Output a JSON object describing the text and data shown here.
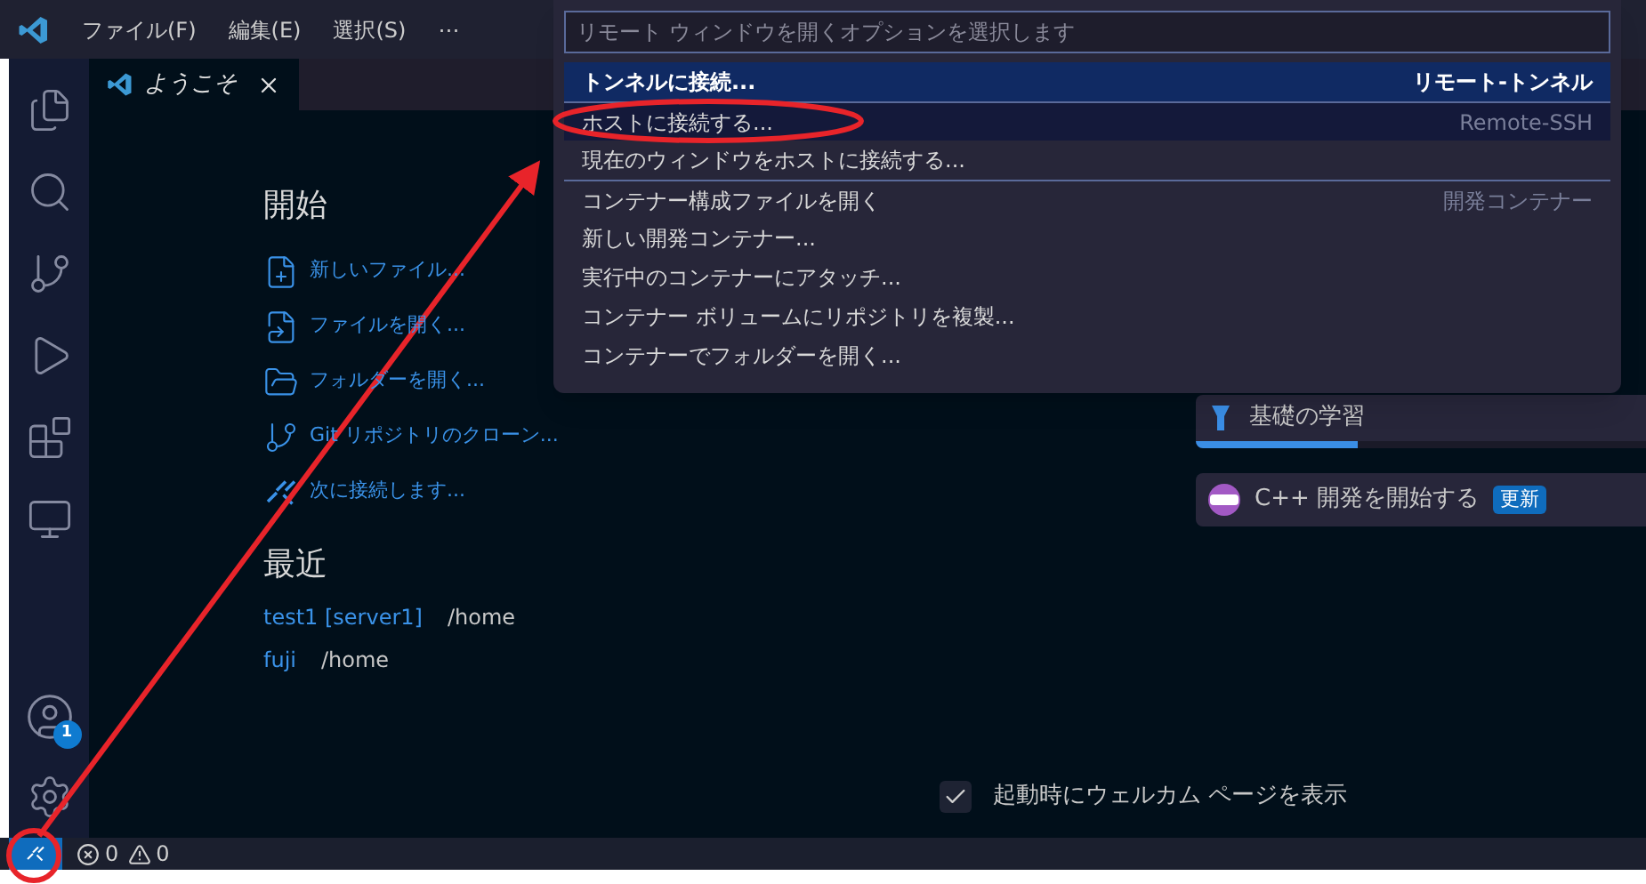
{
  "menu": [
    "ファイル(F)",
    "編集(E)",
    "選択(S)",
    "⋯"
  ],
  "activity_bar": [
    {
      "kind": "files"
    },
    {
      "kind": "search"
    },
    {
      "kind": "source-control"
    },
    {
      "kind": "run"
    },
    {
      "kind": "extensions"
    },
    {
      "kind": "remote"
    }
  ],
  "activity_bottom": {
    "accounts_badge": "1"
  },
  "tab": {
    "label": "ようこそ"
  },
  "start": {
    "title": "開始",
    "items": [
      {
        "kind": "new-file",
        "label": "新しいファイル..."
      },
      {
        "kind": "open-file",
        "label": "ファイルを開く..."
      },
      {
        "kind": "open-folder",
        "label": "フォルダーを開く..."
      },
      {
        "kind": "clone",
        "label": "Git リポジトリのクローン..."
      },
      {
        "kind": "connect",
        "label": "次に接続します..."
      }
    ]
  },
  "recent": {
    "title": "最近",
    "items": [
      {
        "name": "test1 [server1]",
        "path": "/home"
      },
      {
        "name": "fuji",
        "path": "/home"
      }
    ]
  },
  "walkthroughs": [
    {
      "kind": "progress",
      "title": "基礎の学習",
      "level": 0.35
    },
    {
      "kind": "badge",
      "title": "C++ 開発を開始する",
      "badge": "更新"
    }
  ],
  "welcome_checkbox": {
    "label": "起動時にウェルカム ページを表示",
    "checked": true
  },
  "quick_pick": {
    "placeholder": "リモート ウィンドウを開くオプションを選択します",
    "items": [
      {
        "label": "トンネルに接続...",
        "detail": "リモート-トンネル",
        "selected": true,
        "hovered": false,
        "group_start": false
      },
      {
        "label": "ホストに接続する...",
        "detail": "Remote-SSH",
        "selected": false,
        "hovered": true,
        "group_start": true
      },
      {
        "label": "現在のウィンドウをホストに接続する...",
        "selected": false,
        "hovered": false,
        "group_start": false
      },
      {
        "label": "コンテナー構成ファイルを開く",
        "detail": "開発コンテナー",
        "selected": false,
        "hovered": false,
        "group_start": true
      },
      {
        "label": "新しい開発コンテナー...",
        "selected": false,
        "hovered": false,
        "group_start": false
      },
      {
        "label": "実行中のコンテナーにアタッチ...",
        "selected": false,
        "hovered": false,
        "group_start": false
      },
      {
        "label": "コンテナー ボリュームにリポジトリを複製...",
        "selected": false,
        "hovered": false,
        "group_start": false
      },
      {
        "label": "コンテナーでフォルダーを開く...",
        "selected": false,
        "hovered": false,
        "group_start": false
      }
    ]
  },
  "status_bar": {
    "errors": "0",
    "warnings": "0"
  }
}
